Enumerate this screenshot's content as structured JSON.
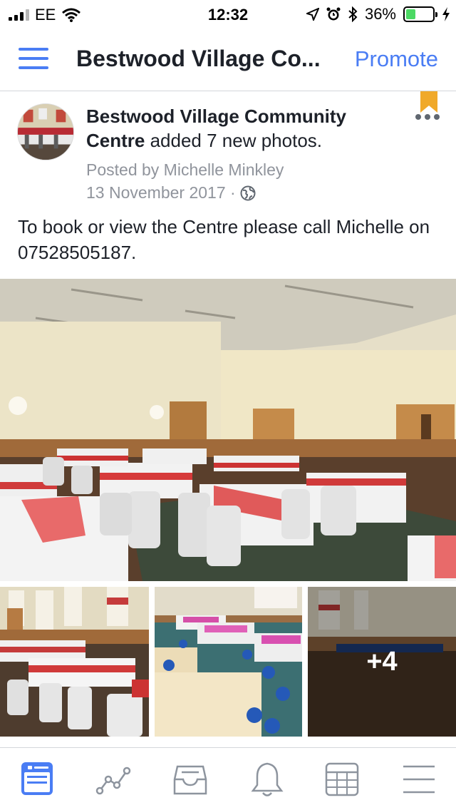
{
  "status_bar": {
    "carrier": "EE",
    "time": "12:32",
    "battery_percent": "36%",
    "battery_level": 0.36
  },
  "navbar": {
    "title": "Bestwood Village Co...",
    "promote_label": "Promote"
  },
  "post": {
    "page_name": "Bestwood Village Community Centre",
    "action_text": "added 7 new photos.",
    "posted_by": "Posted by Michelle Minkley",
    "date": "13 November 2017",
    "separator": "·",
    "body": "To book or view the Centre please call Michelle on 07528505187.",
    "more_photos_count": "+4"
  },
  "icons": {
    "menu": "hamburger-icon",
    "bookmark": "bookmark-icon",
    "more": "more-icon",
    "privacy": "globe-icon"
  },
  "tabbar": {
    "tabs": [
      "page-tab",
      "insights-tab",
      "inbox-tab",
      "notifications-tab",
      "calendar-tab",
      "more-menu-tab"
    ],
    "active": "page-tab"
  },
  "colors": {
    "accent": "#4a7df4",
    "text": "#1d2129",
    "meta": "#90949c",
    "battery": "#4cd964",
    "bookmark": "#f0a92a"
  }
}
